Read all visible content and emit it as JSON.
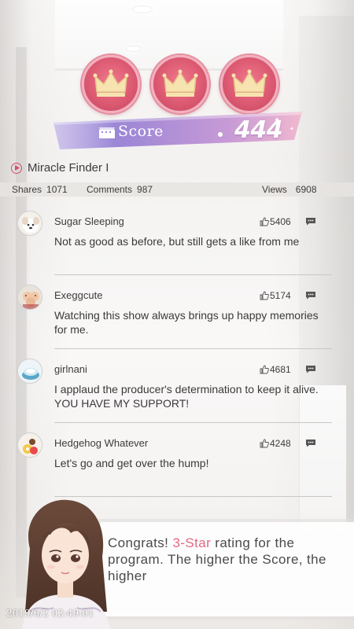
{
  "score": {
    "label": "Score",
    "value": "444",
    "stars": 3
  },
  "program": {
    "title": "Miracle Finder I"
  },
  "stats": {
    "shares_label": "Shares",
    "shares": "1071",
    "comments_label": "Comments",
    "comments": "987",
    "views_label": "Views",
    "views": "6908"
  },
  "comments": [
    {
      "name": "Sugar Sleeping",
      "likes": "5406",
      "text": "Not as good as before, but still gets a like from me"
    },
    {
      "name": "Exeggcute",
      "likes": "5174",
      "text": "Watching this show always brings up happy memories for me."
    },
    {
      "name": "girlnani",
      "likes": "4681",
      "text": "I applaud the producer's determination to keep it alive. YOU HAVE MY SUPPORT!"
    },
    {
      "name": "Hedgehog Whatever",
      "likes": "4248",
      "text": "Let's go and get over the hump!"
    }
  ],
  "dialog": {
    "part1": "Congrats! ",
    "highlight": "3-Star",
    "part2": " rating for the program. The higher the Score, the higher"
  },
  "timestamp": "2019/6/2 02:49:01",
  "colors": {
    "crown_red": "#dc5a72",
    "banner_purple": "#9b86d6",
    "highlight_pink": "#e06a82"
  }
}
